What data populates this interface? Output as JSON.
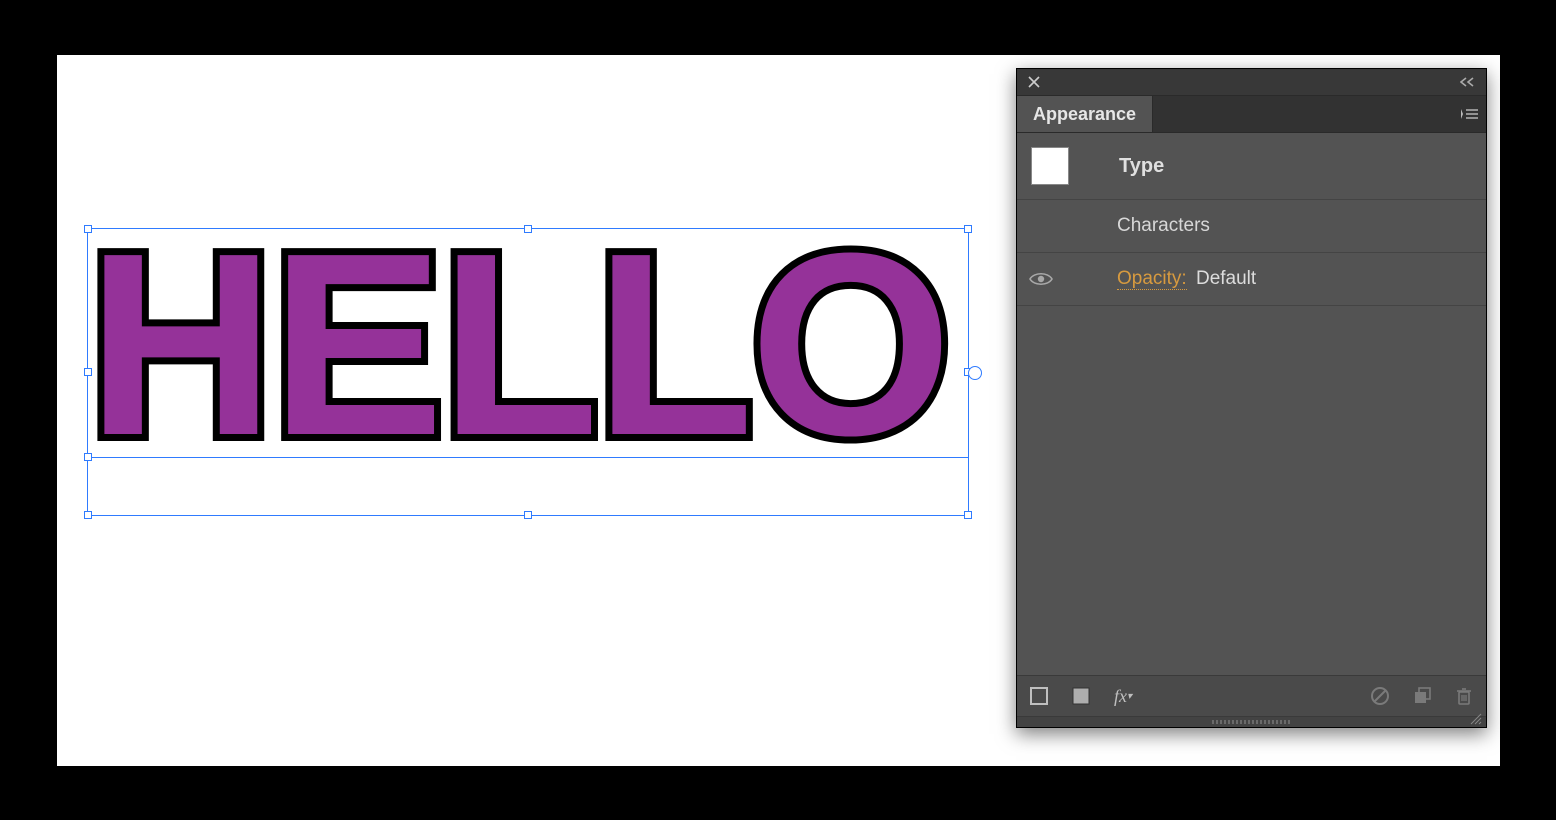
{
  "canvas": {
    "text": "HELLO",
    "fill_color": "#953299",
    "stroke_color": "#000000",
    "stroke_width_px": 14
  },
  "panel": {
    "title": "Appearance",
    "type_row": {
      "label": "Type",
      "swatch_color": "#ffffff"
    },
    "rows": [
      {
        "label": "Characters"
      }
    ],
    "opacity": {
      "label": "Opacity:",
      "value": "Default"
    }
  }
}
